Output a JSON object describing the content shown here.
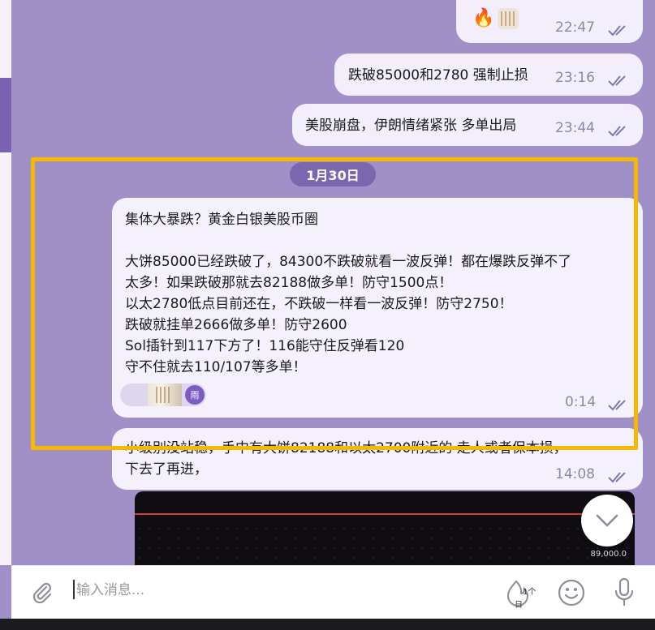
{
  "chat": {
    "msg1": {
      "reactions": [
        "fire-emoji",
        "sticker"
      ],
      "time": "22:47"
    },
    "msg2": {
      "text": "跌破85000和2780 强制止损",
      "time": "23:16"
    },
    "msg3": {
      "text": "美股崩盘，伊朗情绪紧张 多单出局",
      "time": "23:44"
    },
    "date_separator": "1月30日",
    "msg4": {
      "lines": [
        "集体大暴跌？黄金白银美股币圈",
        "",
        "大饼85000已经跌破了，84300不跌破就看一波反弹！都在爆跌反弹不了",
        "太多！如果跌破那就去82188做多单！防守1500点！",
        "以太2780低点目前还在，不跌破一样看一波反弹！防守2750！",
        "跌破就挂单2666做多单！防守2600",
        "Sol插针到117下方了！116能守住反弹看120",
        "守不住就去110/107等多单！"
      ],
      "reaction_badge": "雨",
      "time": "0:14"
    },
    "msg5": {
      "lines": [
        "小级别没站稳，手中有大饼82188和以太2700附近的 走人或者保本损，",
        "下去了再进，"
      ],
      "time": "14:08"
    },
    "chart_preview": {
      "price_label": "89,000.0"
    }
  },
  "input": {
    "placeholder": "输入消息..."
  },
  "schedule_badge": {
    "top": "1个",
    "bottom": "日"
  },
  "colors": {
    "background": "#a18fc8",
    "bubble": "#f4f0fc",
    "date_pill": "#7a67ae",
    "highlight": "#f6b800",
    "ticks": "#7a7aa8"
  },
  "icons": [
    "double-check-icon",
    "attach-icon",
    "schedule-icon",
    "emoji-icon",
    "microphone-icon",
    "chevron-down-icon"
  ]
}
